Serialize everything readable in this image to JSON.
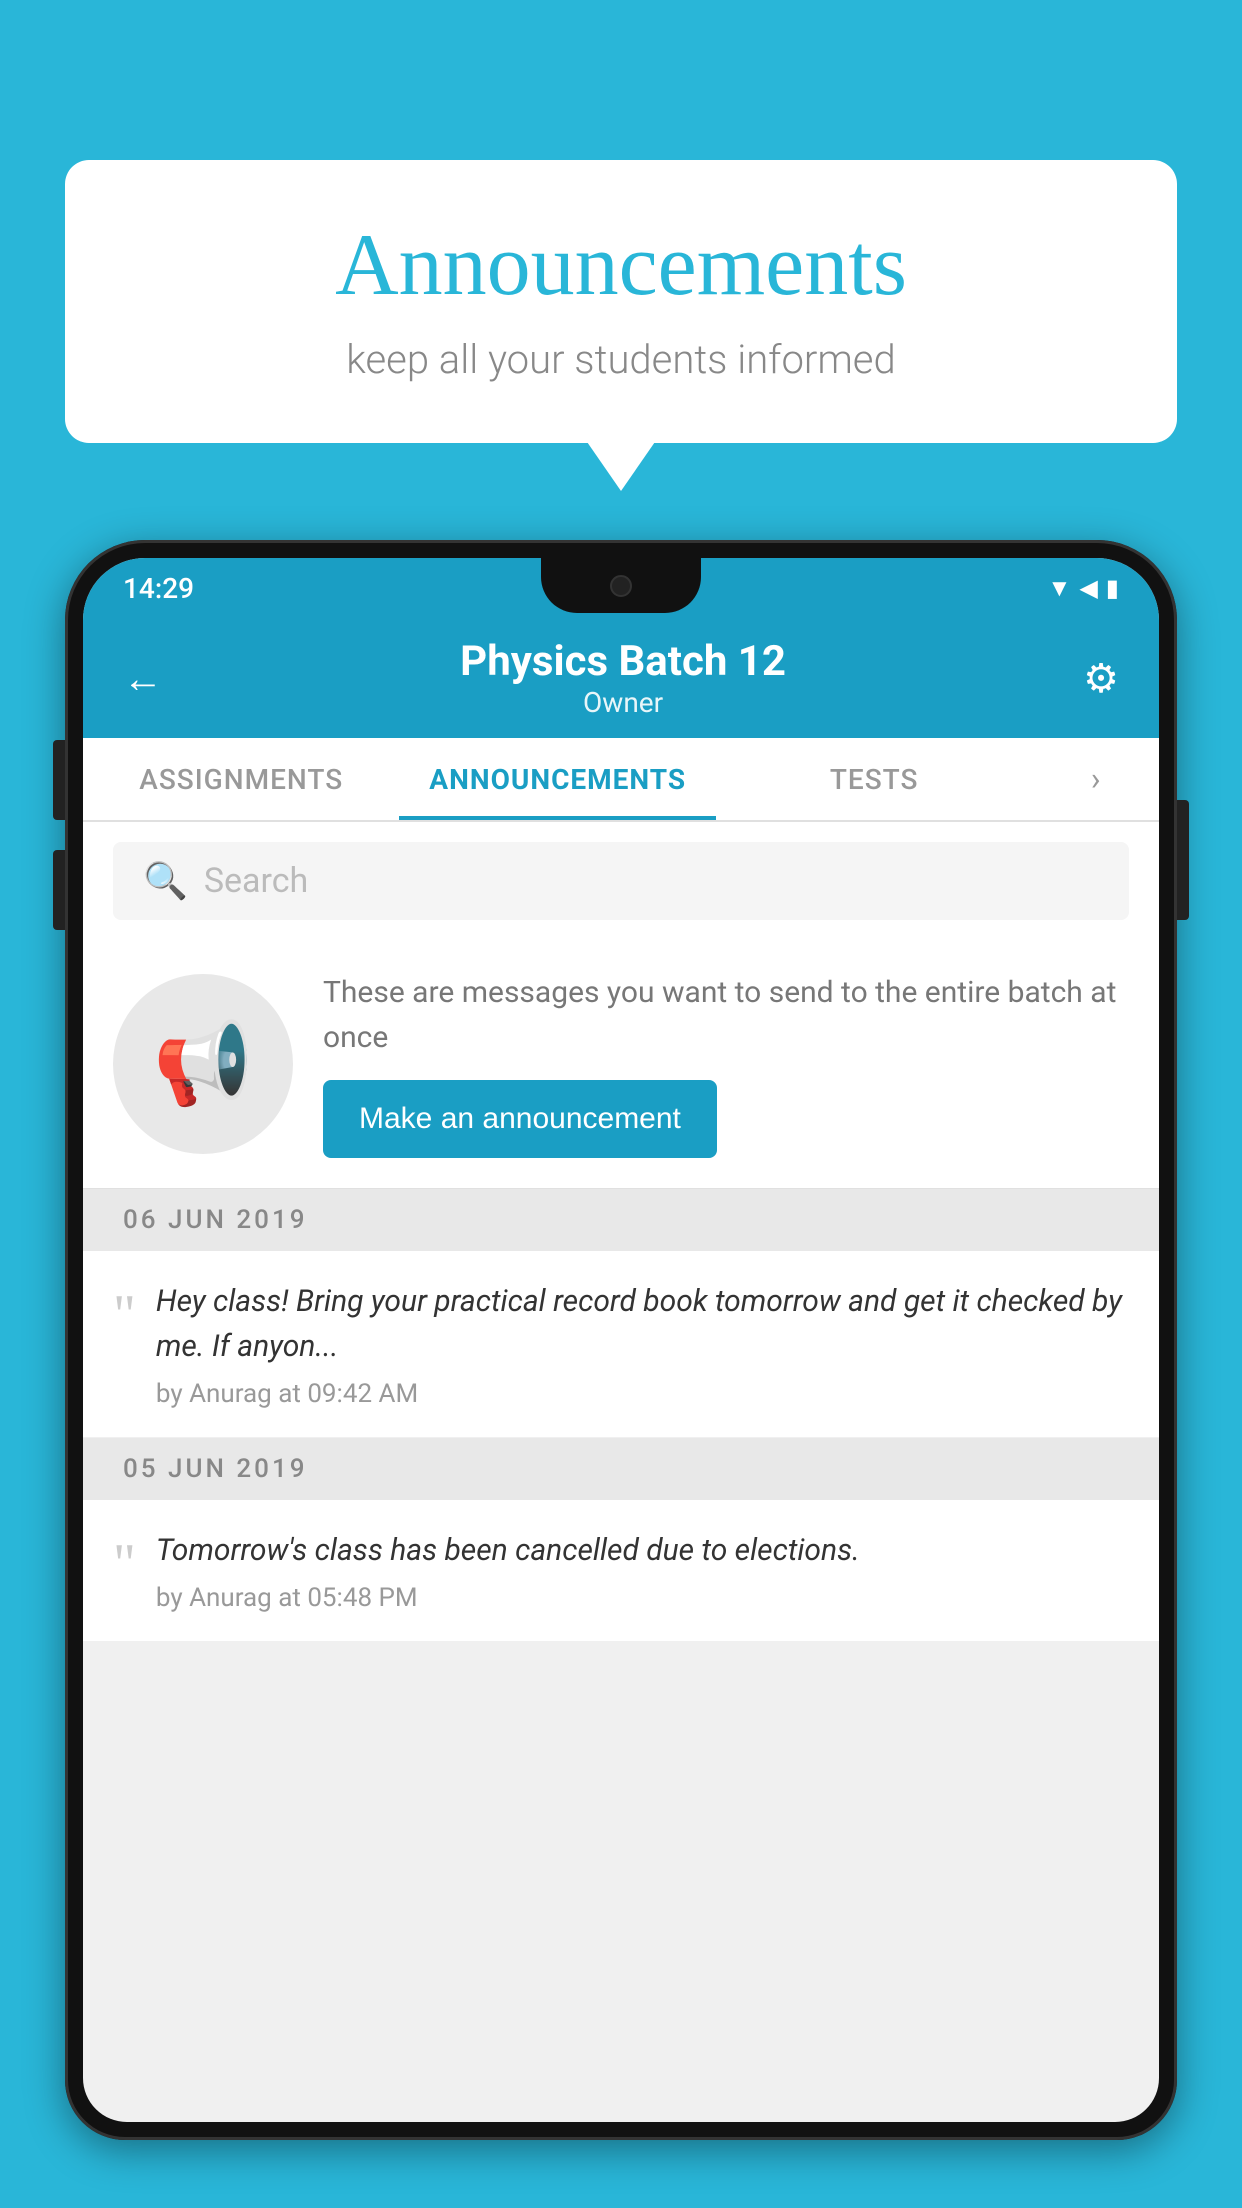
{
  "page": {
    "background_color": "#29b6d8"
  },
  "bubble": {
    "title": "Announcements",
    "subtitle": "keep all your students informed"
  },
  "status_bar": {
    "time": "14:29",
    "wifi": "▲",
    "signal": "▲",
    "battery": "▮"
  },
  "header": {
    "title": "Physics Batch 12",
    "subtitle": "Owner",
    "back_label": "←",
    "gear_label": "⚙"
  },
  "tabs": [
    {
      "label": "ASSIGNMENTS",
      "active": false
    },
    {
      "label": "ANNOUNCEMENTS",
      "active": true
    },
    {
      "label": "TESTS",
      "active": false
    }
  ],
  "search": {
    "placeholder": "Search"
  },
  "announcement_prompt": {
    "description": "These are messages you want to send to the entire batch at once",
    "button_label": "Make an announcement"
  },
  "announcement_list": [
    {
      "date": "06  JUN  2019",
      "text": "Hey class! Bring your practical record book tomorrow and get it checked by me. If anyon...",
      "meta": "by Anurag at 09:42 AM"
    },
    {
      "date": "05  JUN  2019",
      "text": "Tomorrow's class has been cancelled due to elections.",
      "meta": "by Anurag at 05:48 PM"
    }
  ]
}
